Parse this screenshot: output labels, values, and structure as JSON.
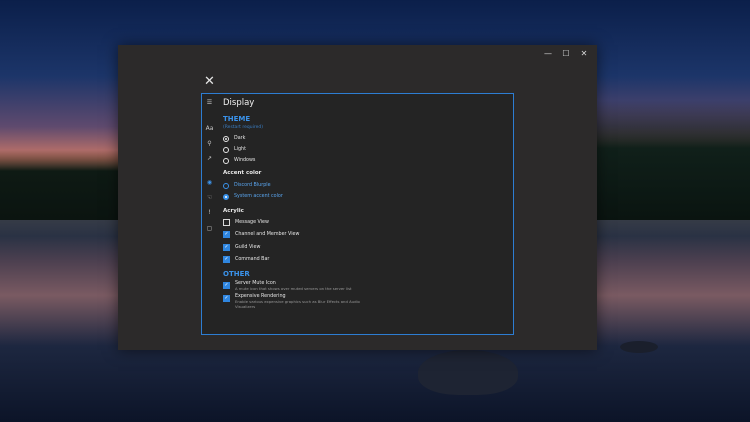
{
  "window": {
    "controls": {
      "minimize": "—",
      "maximize": "☐",
      "close": "✕"
    }
  },
  "panel": {
    "close_glyph": "✕",
    "title": "Display",
    "rail_icons": [
      {
        "name": "menu-icon",
        "glyph": "☰"
      },
      {
        "name": "font-icon",
        "glyph": "Aa"
      },
      {
        "name": "search-icon",
        "glyph": "⚲"
      },
      {
        "name": "share-icon",
        "glyph": "↗"
      },
      {
        "name": "eye-icon",
        "glyph": "◉"
      },
      {
        "name": "hand-icon",
        "glyph": "☜"
      },
      {
        "name": "alert-icon",
        "glyph": "!"
      },
      {
        "name": "lock-icon",
        "glyph": "▢"
      }
    ],
    "theme": {
      "header": "THEME",
      "note": "(Restart required)",
      "options": [
        "Dark",
        "Light",
        "Windows"
      ],
      "selected": "Dark"
    },
    "accent": {
      "label": "Accent color",
      "options": [
        "Discord Blurple",
        "System accent color"
      ],
      "selected": "System accent color"
    },
    "acrylic": {
      "label": "Acrylic",
      "options": [
        {
          "label": "Message View",
          "checked": false
        },
        {
          "label": "Channel and Member View",
          "checked": true
        },
        {
          "label": "Guild View",
          "checked": true
        },
        {
          "label": "Command Bar",
          "checked": true
        }
      ]
    },
    "other": {
      "header": "OTHER",
      "options": [
        {
          "label": "Server Mute Icon",
          "desc": "A mute icon that shows over muted servers on the server list",
          "checked": true
        },
        {
          "label": "Expensive Rendering",
          "desc": "Enable various expensive graphics such as Blur Effects and Audio Visualizers",
          "checked": true
        }
      ]
    },
    "check_glyph": "✓",
    "accent_color": "#3a92ea"
  }
}
